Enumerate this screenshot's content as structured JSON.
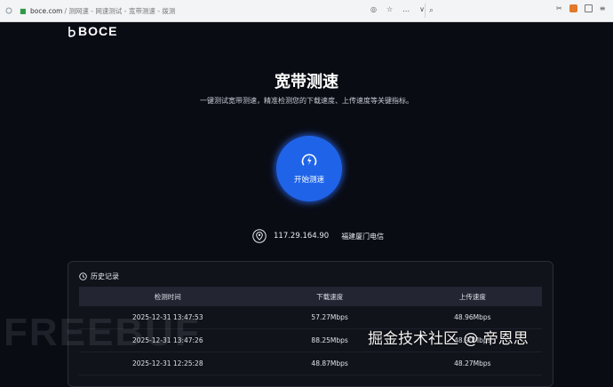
{
  "browser": {
    "host": "boce.com",
    "path_title": " / 测网速 - 网速测试 - 宽带测速 - 拨测"
  },
  "logo": {
    "text": "BOCE"
  },
  "hero": {
    "title": "宽带测速",
    "subtitle": "一键测试宽带测速，精准检测您的下载速度、上传速度等关键指标。",
    "start_label": "开始测速"
  },
  "client": {
    "ip": "117.29.164.90",
    "isp": "福建厦门电信"
  },
  "history": {
    "title": "历史记录",
    "columns": [
      "检测时间",
      "下载速度",
      "上传速度"
    ],
    "rows": [
      [
        "2025-12-31 13:47:53",
        "57.27Mbps",
        "48.96Mbps"
      ],
      [
        "2025-12-31 13:47:26",
        "88.25Mbps",
        "48.90Mbps"
      ],
      [
        "2025-12-31 12:25:28",
        "48.87Mbps",
        "48.27Mbps"
      ]
    ]
  },
  "watermark": {
    "text": "掘金技术社区 @ 帝恩思",
    "freebuf": "FREEBUF"
  },
  "colors": {
    "background": "#0a0c14",
    "accent": "#1f64e8",
    "panel": "#11131b"
  }
}
